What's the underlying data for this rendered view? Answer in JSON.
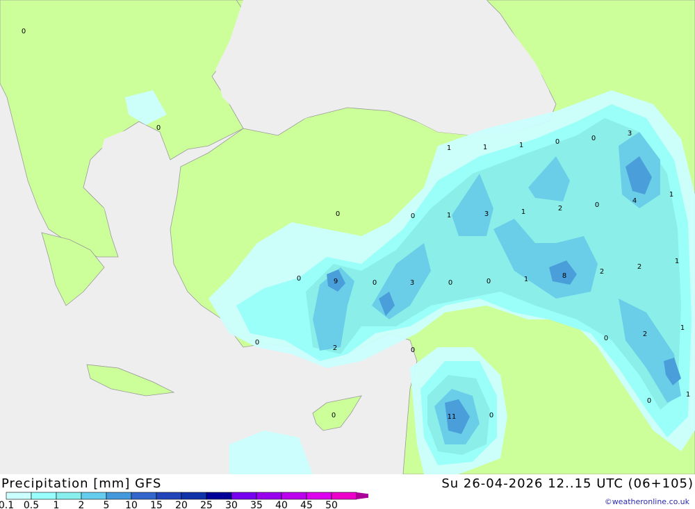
{
  "title": "Precipitation [mm] GFS",
  "timestamp": "Su 26-04-2026 12..15 UTC (06+105)",
  "credit": "©weatheronline.co.uk",
  "colors": {
    "sea": "#eeeeee",
    "land": "#ccff99",
    "border": "#888888",
    "scale": [
      "#ccffff",
      "#99ffff",
      "#88eeee",
      "#66ccee",
      "#4499dd",
      "#3366cc",
      "#2244bb",
      "#1133aa",
      "#000099",
      "#7700ee",
      "#9900ee",
      "#bb00ee",
      "#dd00ee",
      "#ee00cc",
      "#aa0099"
    ]
  },
  "legend": {
    "labels": [
      "0.1",
      "0.5",
      "1",
      "2",
      "5",
      "10",
      "15",
      "20",
      "25",
      "30",
      "35",
      "40",
      "45",
      "50"
    ]
  },
  "map_values": [
    "0",
    "0",
    "1",
    "1",
    "1",
    "0",
    "0",
    "3",
    "0",
    "0",
    "1",
    "3",
    "1",
    "2",
    "0",
    "4",
    "1",
    "0",
    "9",
    "0",
    "3",
    "0",
    "0",
    "1",
    "8",
    "2",
    "2",
    "1",
    "0",
    "2",
    "0",
    "2",
    "1",
    "0",
    "0",
    "11",
    "0",
    "0",
    "1"
  ]
}
